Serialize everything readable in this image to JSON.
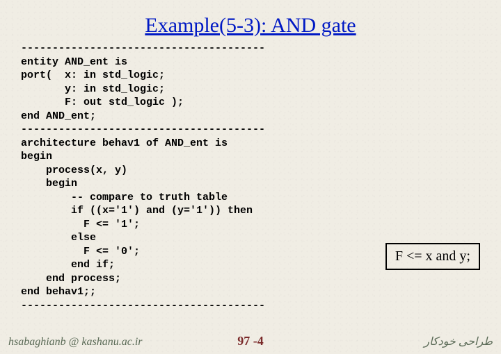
{
  "title": "Example(5-3): AND gate",
  "code": "---------------------------------------\nentity AND_ent is\nport(  x: in std_logic;\n       y: in std_logic;\n       F: out std_logic );\nend AND_ent;\n---------------------------------------\narchitecture behav1 of AND_ent is\nbegin\n    process(x, y)\n    begin\n        -- compare to truth table\n        if ((x='1') and (y='1')) then\n          F <= '1';\n        else\n          F <= '0';\n        end if;\n    end process;\nend behav1;;\n---------------------------------------",
  "callout": "F <= x and y;",
  "footer": {
    "left": "hsabaghianb @ kashanu.ac.ir",
    "center": "97 -4",
    "right": "طراحی خودکار"
  },
  "chart_data": {
    "type": "table",
    "title": "VHDL AND gate example source code",
    "entity": "AND_ent",
    "ports": [
      {
        "name": "x",
        "dir": "in",
        "type": "std_logic"
      },
      {
        "name": "y",
        "dir": "in",
        "type": "std_logic"
      },
      {
        "name": "F",
        "dir": "out",
        "type": "std_logic"
      }
    ],
    "architecture": "behav1",
    "behavior": "F <= '1' when x='1' and y='1' else '0'",
    "equivalent_concurrent": "F <= x and y;"
  }
}
